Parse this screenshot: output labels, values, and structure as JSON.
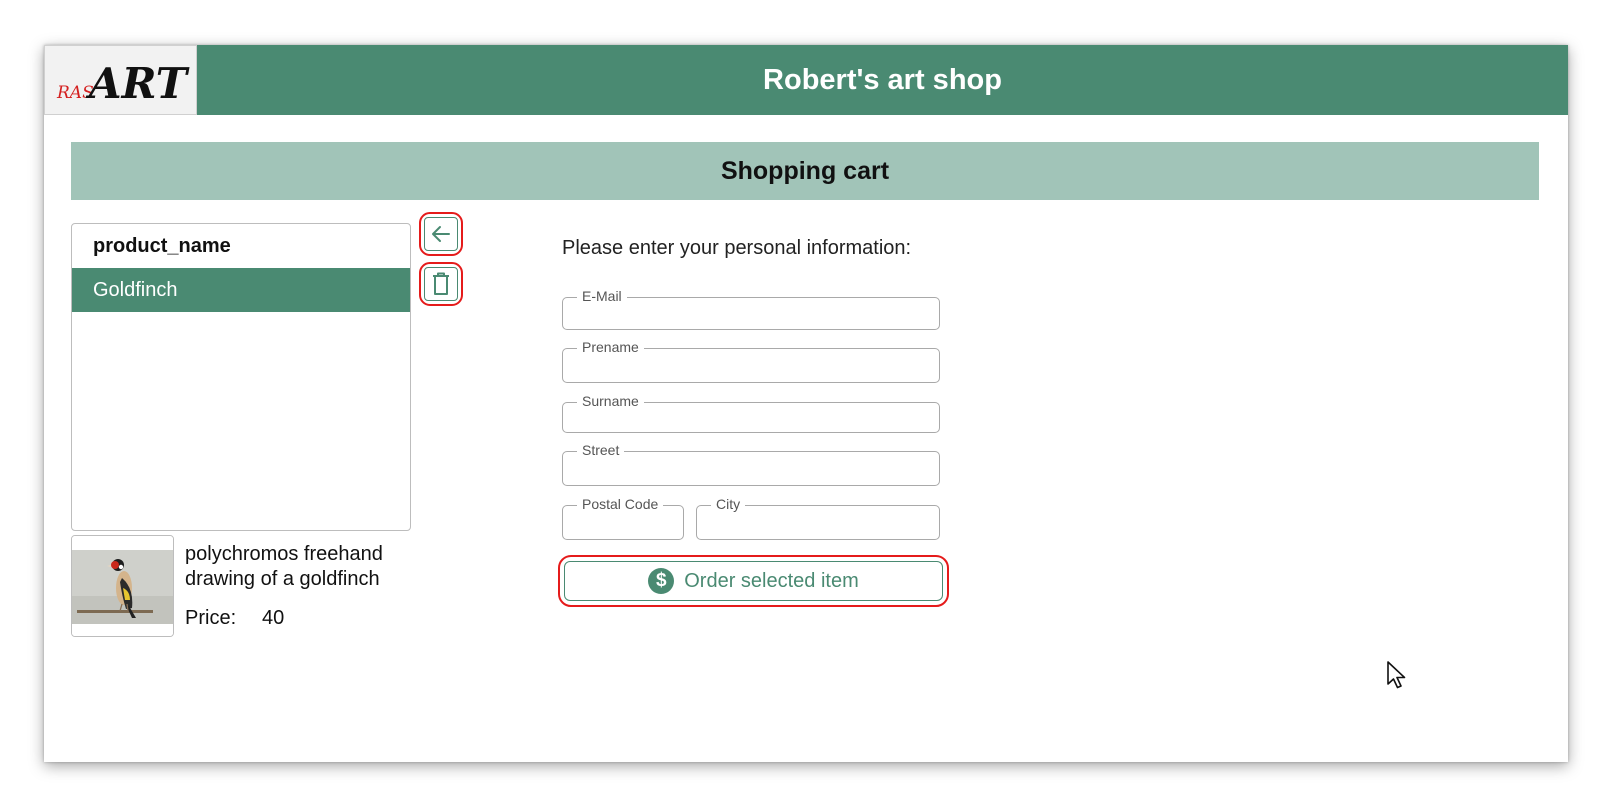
{
  "app": {
    "logo_prefix": "RAS",
    "logo_main": "ART",
    "title": "Robert's art shop"
  },
  "section": {
    "title": "Shopping cart"
  },
  "cart": {
    "column_header": "product_name",
    "items": [
      {
        "label": "Goldfinch",
        "selected": true
      }
    ],
    "back_icon": "arrow-left-icon",
    "delete_icon": "trash-icon"
  },
  "product": {
    "description": "polychromos freehand drawing of a goldfinch",
    "price_label": "Price:",
    "price_value": "40"
  },
  "form": {
    "prompt": "Please enter your personal information:",
    "fields": {
      "email": {
        "label": "E-Mail",
        "value": ""
      },
      "prename": {
        "label": "Prename",
        "value": ""
      },
      "surname": {
        "label": "Surname",
        "value": ""
      },
      "street": {
        "label": "Street",
        "value": ""
      },
      "postal_code": {
        "label": "Postal Code",
        "value": ""
      },
      "city": {
        "label": "City",
        "value": ""
      }
    },
    "order_button": {
      "label": "Order selected item",
      "icon": "dollar-icon"
    }
  },
  "colors": {
    "header": "#4a8a72",
    "section_bar": "#a1c4b8",
    "highlight_outline": "#e51b1b"
  }
}
